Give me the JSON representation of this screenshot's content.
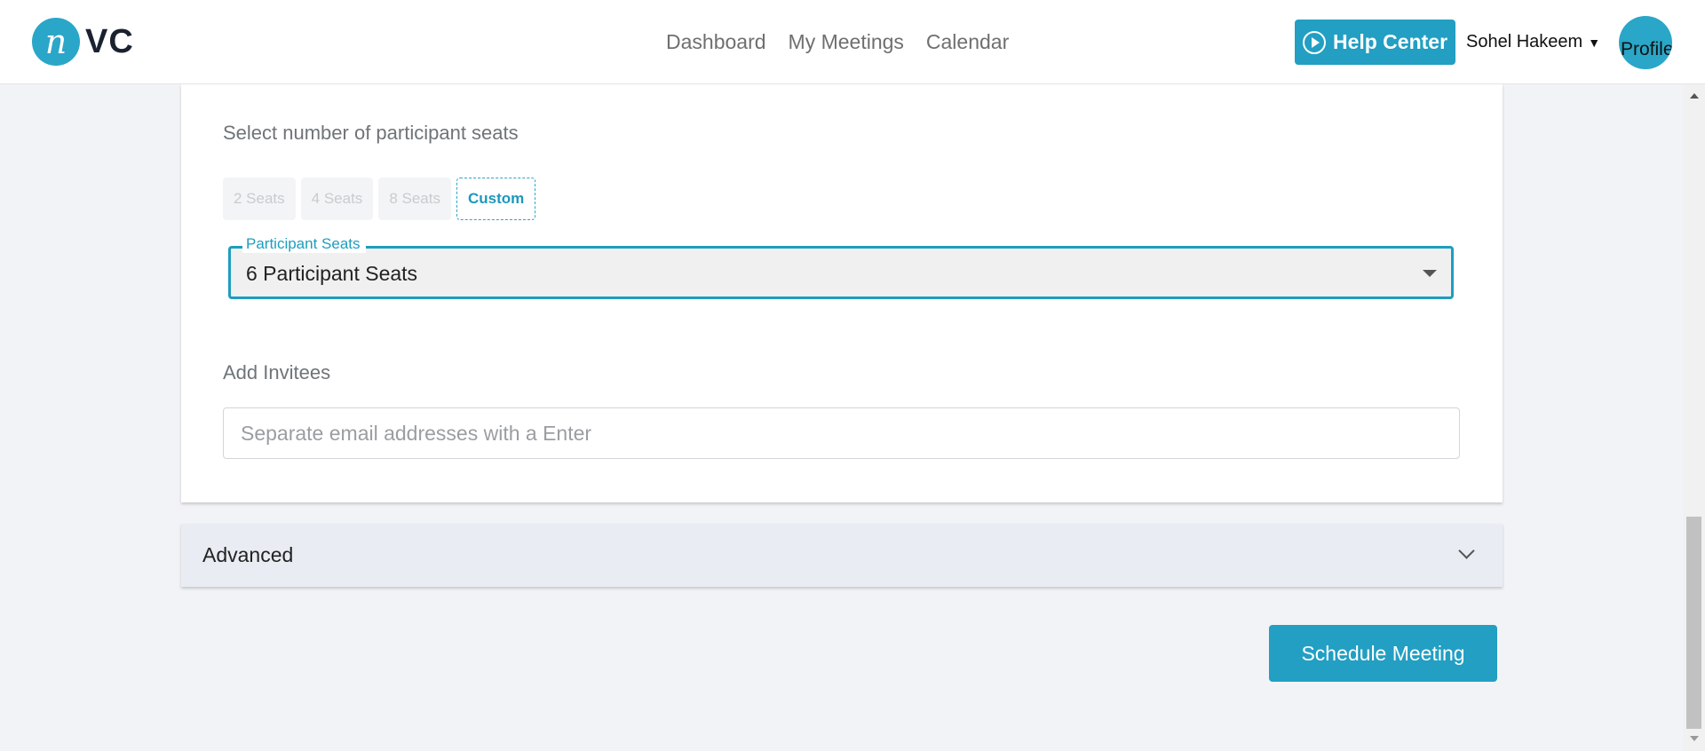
{
  "header": {
    "logo_mark": "n",
    "logo_text": "VC",
    "nav": [
      "Dashboard",
      "My Meetings",
      "Calendar"
    ],
    "help_label": "Help Center",
    "user_name": "Sohel Hakeem",
    "avatar_alt": "Profile"
  },
  "form": {
    "seats_label": "Select number of participant seats",
    "seat_options": [
      "2 Seats",
      "4 Seats",
      "8 Seats",
      "Custom"
    ],
    "selected_option": "Custom",
    "select_legend": "Participant Seats",
    "select_value": "6 Participant Seats",
    "invitees_label": "Add Invitees",
    "invitees_placeholder": "Separate email addresses with a Enter"
  },
  "advanced": {
    "label": "Advanced"
  },
  "actions": {
    "schedule_label": "Schedule Meeting"
  },
  "colors": {
    "accent": "#229fc3",
    "background": "#f2f3f6",
    "accordion": "#e9ecf3"
  }
}
